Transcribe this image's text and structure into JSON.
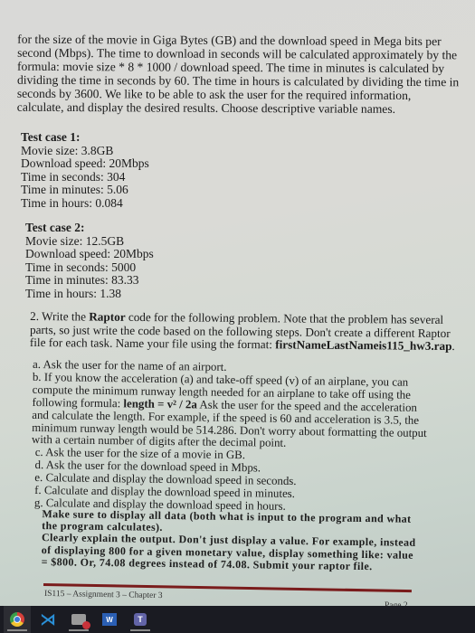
{
  "document": {
    "intro_paragraph": "for the size of the movie in Giga Bytes (GB) and the download speed in Mega bits per second (Mbps). The time to download in seconds will be calculated approximately by the formula: movie size * 8 * 1000 / download speed. The time in minutes is calculated by dividing the time in seconds by 60. The time in hours is calculated by dividing the time in seconds by 3600.  We like to be able to ask the user for the required information, calculate, and display the desired results. Choose descriptive variable names.",
    "test_cases": [
      {
        "heading": "Test case 1:",
        "lines": [
          "Movie size: 3.8GB",
          "Download speed: 20Mbps",
          "Time in seconds: 304",
          "Time in minutes: 5.06",
          "Time in hours: 0.084"
        ]
      },
      {
        "heading": "Test case 2:",
        "lines": [
          "Movie size: 12.5GB",
          "Download speed: 20Mbps",
          "Time in seconds: 5000",
          "Time in minutes: 83.33",
          "Time in hours: 1.38"
        ]
      }
    ],
    "question2": {
      "prefix": "2. Write the ",
      "bold_word": "Raptor",
      "middle": " code for the following problem. Note that the problem has several parts, so just write the code based on the following steps. Don't create a different Raptor file for each task. Name your file using the format: ",
      "filename": "firstNameLastNameis115_hw3.rap",
      "suffix": "."
    },
    "steps": {
      "a": "a. Ask the user for the name of an airport.",
      "b_prefix": "b. If you know the acceleration (a) and take-off speed (v) of an airplane, you can compute the minimum runway length needed for an airplane to take off using the following formula: ",
      "b_formula": "length = v² / 2a",
      "b_suffix": " Ask the user for the speed and the acceleration and calculate the length. For example, if the speed is 60 and acceleration is 3.5, the minimum runway length would be 514.286. Don't worry about formatting the output with a certain number of digits after the decimal point.",
      "c": "c. Ask the user for the size of a movie in GB.",
      "d": "d. Ask the user for the download speed in Mbps.",
      "e": "e. Calculate and display the download speed in seconds.",
      "f": "f. Calculate and display the download speed in minutes.",
      "g": "g. Calculate and display the download speed in hours."
    },
    "notes": {
      "display_all": "Make sure to display all data (both what is input to the program and what the program calculates).",
      "explain": "Clearly explain the output. Don't just display a value. For example, instead of displaying 800 for a given monetary value, display something like: value = $800. Or, 74.08 degrees instead of 74.08. Submit your raptor file."
    },
    "footer": {
      "left": "IS115 – Assignment 3 – Chapter 3",
      "right": "Page 2"
    }
  },
  "taskbar": {
    "apps": [
      {
        "name": "Google Chrome",
        "icon": "chrome-icon"
      },
      {
        "name": "Visual Studio Code",
        "icon": "vscode-icon",
        "glyph": "⋊"
      },
      {
        "name": "Chat",
        "icon": "chat-icon"
      },
      {
        "name": "Microsoft Word",
        "icon": "word-icon",
        "glyph": "W"
      },
      {
        "name": "Microsoft Teams",
        "icon": "teams-icon",
        "glyph": "T"
      }
    ]
  },
  "colors": {
    "footer_rule": "#7a1c1c",
    "taskbar_bg": "#1a1b22"
  }
}
